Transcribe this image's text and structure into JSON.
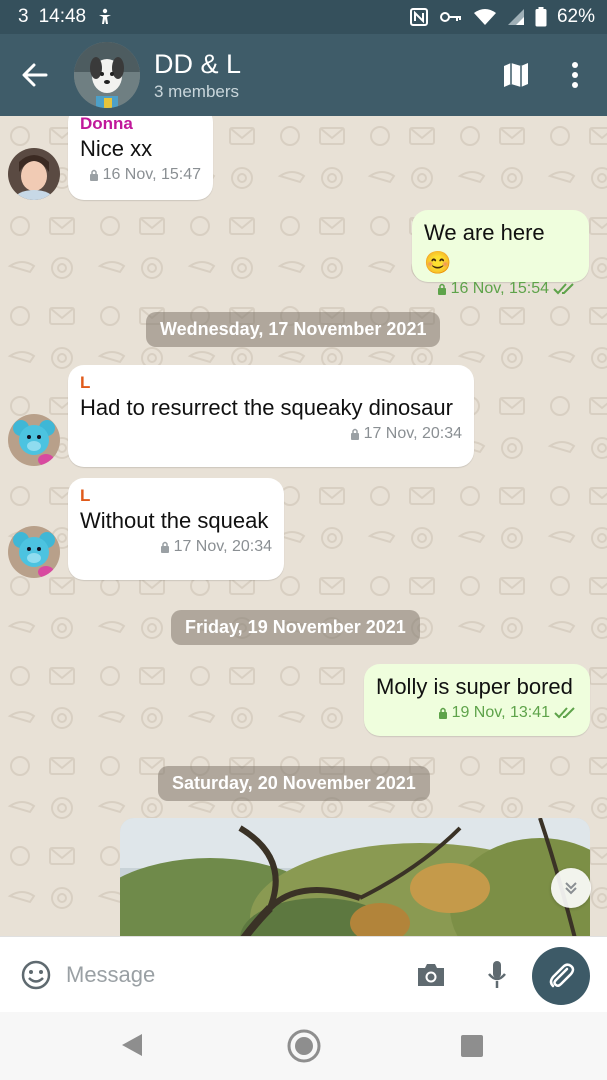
{
  "status_bar": {
    "carrier": "3",
    "time": "14:48",
    "battery": "62%",
    "icons": [
      "accessibility-icon",
      "nfc-icon",
      "key-icon",
      "wifi-icon",
      "signal-icon",
      "battery-icon"
    ]
  },
  "header": {
    "title": "DD & L",
    "subtitle": "3 members"
  },
  "messages": [
    {
      "type": "in",
      "sender": "Donna",
      "sender_color": "#c0189a",
      "text": "Nice xx",
      "time": "16 Nov, 15:47"
    },
    {
      "type": "out",
      "text": "We are here 😊",
      "time": "16 Nov, 15:54"
    },
    {
      "type": "in",
      "sender": "L",
      "sender_color": "#e05a1a",
      "text": "Had to resurrect the squeaky dinosaur",
      "time": "17 Nov, 20:34"
    },
    {
      "type": "in",
      "sender": "L",
      "sender_color": "#e05a1a",
      "text": "Without the squeak",
      "time": "17 Nov, 20:34"
    },
    {
      "type": "out",
      "text": "Molly is super bored",
      "time": "19 Nov, 13:41"
    }
  ],
  "date_separators": [
    "Wednesday, 17 November 2021",
    "Friday, 19 November 2021",
    "Saturday, 20 November 2021"
  ],
  "composer": {
    "placeholder": "Message"
  },
  "colors": {
    "header_bg": "#3f5c69",
    "status_bg": "#35505c",
    "outgoing_bubble": "#effedd",
    "incoming_bubble": "#ffffff",
    "attach_button": "#3d5a67"
  }
}
